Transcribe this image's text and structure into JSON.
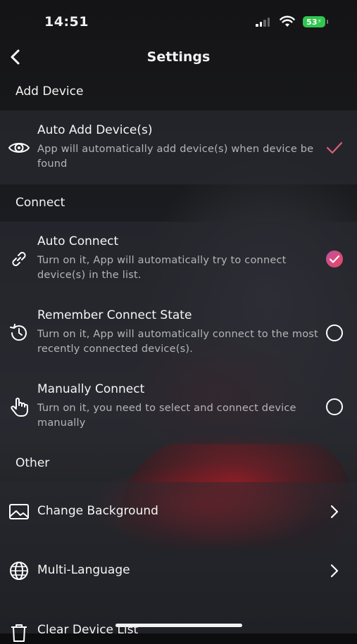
{
  "status_bar": {
    "time": "14:51",
    "battery": "53"
  },
  "nav": {
    "title": "Settings"
  },
  "sections": {
    "add_device": "Add Device",
    "connect": "Connect",
    "other": "Other"
  },
  "add_device": {
    "auto_add": {
      "label": "Auto Add Device(s)",
      "desc": "App will automatically add device(s) when device be found",
      "checked": true
    }
  },
  "connect": {
    "auto_connect": {
      "label": "Auto Connect",
      "desc": "Turn on it, App will automatically try to connect device(s) in the list.",
      "selected": true
    },
    "remember": {
      "label": "Remember Connect State",
      "desc": "Turn on it, App will automatically connect to the most recently connected device(s).",
      "selected": false
    },
    "manual": {
      "label": "Manually Connect",
      "desc": "Turn on it, you need to select and connect device manually",
      "selected": false
    }
  },
  "other": {
    "background": {
      "label": "Change Background"
    },
    "language": {
      "label": "Multi-Language"
    },
    "clear": {
      "label": "Clear Device List"
    }
  },
  "colors": {
    "accent_check": "#d8607c",
    "radio_selected": "#e04a6e",
    "battery": "#31c650"
  }
}
